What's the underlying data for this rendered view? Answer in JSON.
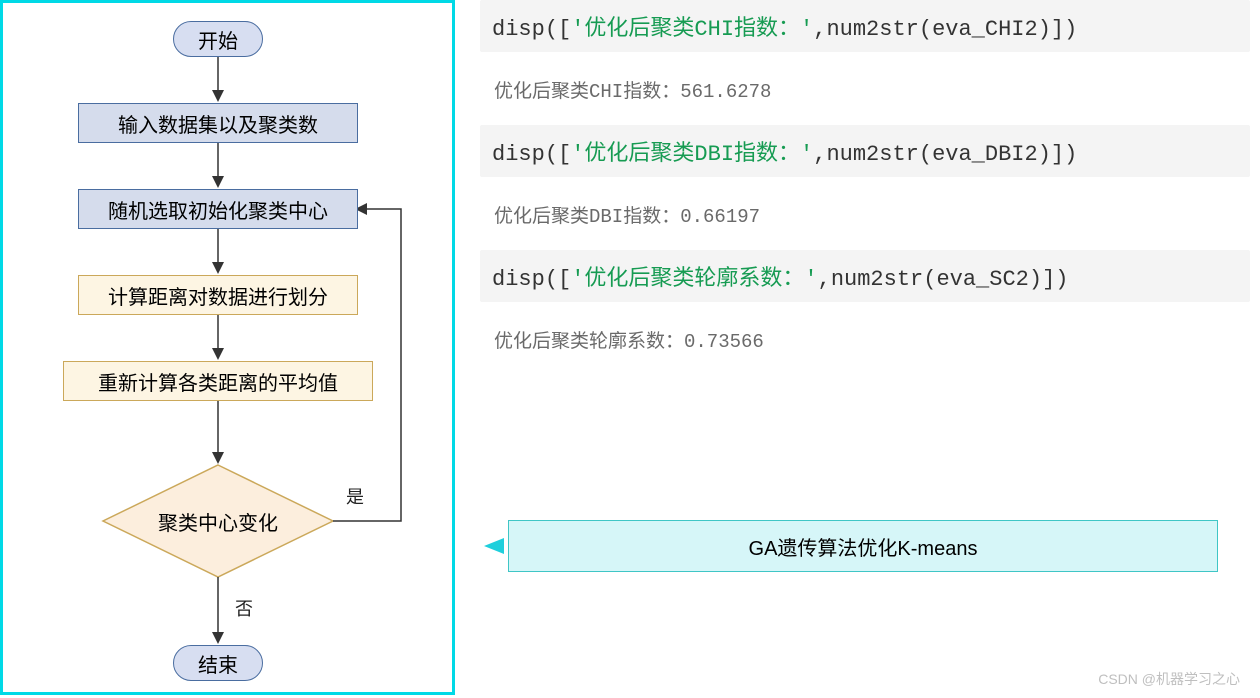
{
  "flowchart": {
    "start": "开始",
    "step1": "输入数据集以及聚类数",
    "step2": "随机选取初始化聚类中心",
    "step3": "计算距离对数据进行划分",
    "step4": "重新计算各类距离的平均值",
    "decision": "聚类中心变化",
    "label_yes": "是",
    "label_no": "否",
    "end": "结束"
  },
  "code": {
    "disp_fn": "disp",
    "num2str_fn": "num2str",
    "str1": "'优化后聚类CHI指数：'",
    "var1": "eva_CHI2",
    "out1": "优化后聚类CHI指数：561.6278",
    "str2": "'优化后聚类DBI指数：'",
    "var2": "eva_DBI2",
    "out2": "优化后聚类DBI指数：0.66197",
    "str3": "'优化后聚类轮廓系数：'",
    "var3": "eva_SC2",
    "out3": "优化后聚类轮廓系数：0.73566"
  },
  "ga_box": "GA遗传算法优化K-means",
  "watermark": "CSDN @机器学习之心"
}
